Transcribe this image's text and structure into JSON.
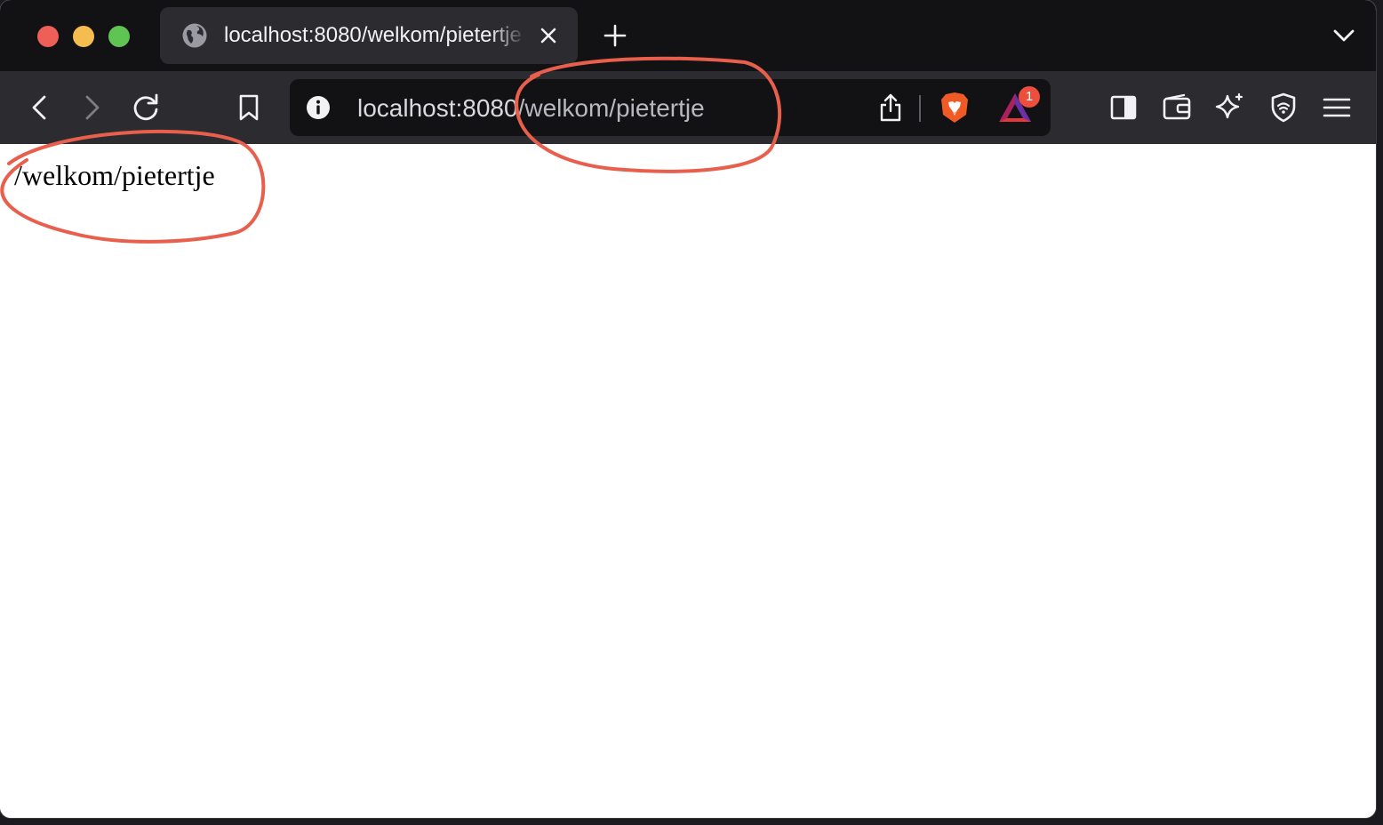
{
  "tab": {
    "title": "localhost:8080/welkom/pietertje",
    "close_icon": "close-icon",
    "favicon": "globe-icon"
  },
  "toolbar": {
    "back_icon": "chevron-left-icon",
    "forward_icon": "chevron-right-icon",
    "reload_icon": "reload-icon",
    "bookmark_icon": "bookmark-icon",
    "sidebar_icon": "sidebar-icon",
    "wallet_icon": "wallet-icon",
    "leo_icon": "sparkle-icon",
    "vpn_icon": "shield-icon",
    "menu_icon": "hamburger-menu-icon"
  },
  "url": {
    "host": "localhost:8080",
    "path": "/welkom/pietertje"
  },
  "rewards": {
    "badge_count": "1"
  },
  "page": {
    "text": "/welkom/pietertje"
  },
  "colors": {
    "annotation": "#e8604d",
    "tabbar_bg": "#121215",
    "toolbar_bg": "#2b2b30"
  }
}
